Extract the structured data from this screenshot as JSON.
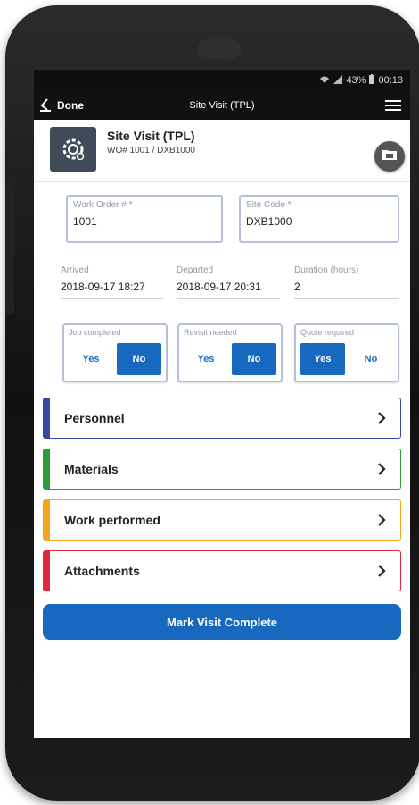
{
  "status": {
    "signal": "⊿",
    "battery": "43%",
    "time": "00:13"
  },
  "appbar": {
    "done_label": "Done",
    "title": "Site Visit (TPL)"
  },
  "header": {
    "title": "Site Visit (TPL)",
    "subtitle": "WO# 1001 / DXB1000"
  },
  "work_order": {
    "label": "Work Order # *",
    "value": "1001"
  },
  "site_code": {
    "label": "Site Code *",
    "value": "DXB1000"
  },
  "arrived": {
    "label": "Arrived",
    "value": "2018-09-17 18:27"
  },
  "departed": {
    "label": "Departed",
    "value": "2018-09-17 20:31"
  },
  "duration": {
    "label": "Duration (hours)",
    "value": "2"
  },
  "toggles": [
    {
      "label": "Job completed",
      "yes": "Yes",
      "no": "No",
      "selected": "No"
    },
    {
      "label": "Revisit needed",
      "yes": "Yes",
      "no": "No",
      "selected": "No"
    },
    {
      "label": "Quote required",
      "yes": "Yes",
      "no": "No",
      "selected": "Yes"
    }
  ],
  "sections": [
    {
      "label": "Personnel",
      "color": "#3b46a3"
    },
    {
      "label": "Materials",
      "color": "#2e9a3a"
    },
    {
      "label": "Work performed",
      "color": "#f3a61b"
    },
    {
      "label": "Attachments",
      "color": "#e0283a"
    }
  ],
  "action": {
    "label": "Mark Visit Complete",
    "color": "#1769bf"
  }
}
